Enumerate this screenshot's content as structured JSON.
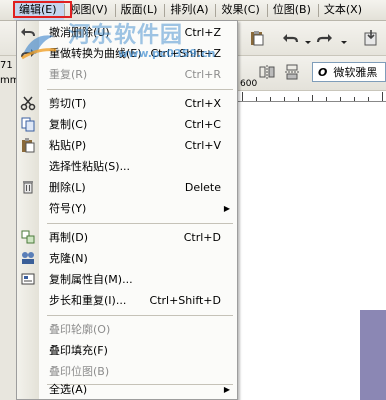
{
  "menubar": {
    "items": [
      {
        "label": "编辑(E)"
      },
      {
        "label": "视图(V)"
      },
      {
        "label": "版面(L)"
      },
      {
        "label": "排列(A)"
      },
      {
        "label": "效果(C)"
      },
      {
        "label": "位图(B)"
      },
      {
        "label": "文本(X)"
      }
    ]
  },
  "propbar": {
    "font_name": "微软雅黑",
    "font_icon": "O",
    "left_value": "71 m",
    "unit": "mm"
  },
  "ruler": {
    "label": "600"
  },
  "menu": {
    "items": [
      {
        "label": "撤消删除(U)",
        "shortcut": "Ctrl+Z",
        "disabled": false
      },
      {
        "label": "重做转换为曲线(E)",
        "shortcut": "Ctrl+Shift+Z",
        "disabled": false
      },
      {
        "label": "重复(R)",
        "shortcut": "Ctrl+R",
        "disabled": true
      },
      {
        "label": "剪切(T)",
        "shortcut": "Ctrl+X",
        "disabled": false
      },
      {
        "label": "复制(C)",
        "shortcut": "Ctrl+C",
        "disabled": false
      },
      {
        "label": "粘贴(P)",
        "shortcut": "Ctrl+V",
        "disabled": false
      },
      {
        "label": "选择性粘贴(S)...",
        "shortcut": "",
        "disabled": false
      },
      {
        "label": "删除(L)",
        "shortcut": "Delete",
        "disabled": false
      },
      {
        "label": "符号(Y)",
        "shortcut": "",
        "disabled": false
      },
      {
        "label": "再制(D)",
        "shortcut": "Ctrl+D",
        "disabled": false
      },
      {
        "label": "克隆(N)",
        "shortcut": "",
        "disabled": false
      },
      {
        "label": "复制属性自(M)...",
        "shortcut": "",
        "disabled": false
      },
      {
        "label": "步长和重复(I)...",
        "shortcut": "Ctrl+Shift+D",
        "disabled": false
      },
      {
        "label": "叠印轮廓(O)",
        "shortcut": "",
        "disabled": true
      },
      {
        "label": "叠印填充(F)",
        "shortcut": "",
        "disabled": false
      },
      {
        "label": "叠印位图(B)",
        "shortcut": "",
        "disabled": true
      },
      {
        "label": "全选(A)",
        "shortcut": "",
        "disabled": false
      }
    ]
  },
  "watermark": {
    "text": "河东软件园",
    "url": "www.pc0359.cn"
  },
  "colors": {
    "highlight": "#c1d2ee",
    "red_box": "#e02020",
    "page_shadow": "#8b87b4"
  }
}
